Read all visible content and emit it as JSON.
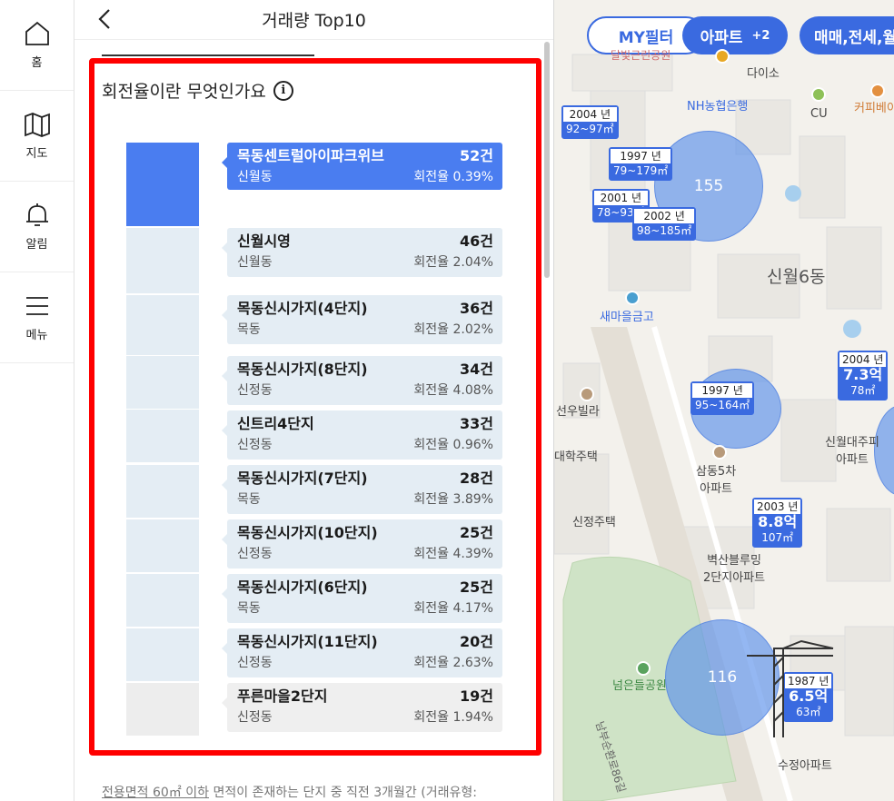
{
  "nav": {
    "home": "홈",
    "map": "지도",
    "alert": "알림",
    "menu": "메뉴"
  },
  "panel": {
    "title": "거래량 Top10",
    "section_title": "회전율이란 무엇인가요",
    "footnote_underlined": "전용면적 60㎡ 이하",
    "footnote_rest": " 면적이 존재하는 단지 중 직전 3개월간 (거래유형:"
  },
  "ranking": [
    {
      "name": "목동센트럴아이파크위브",
      "count": "52건",
      "dong": "신월동",
      "rate": "회전율 0.39%"
    },
    {
      "name": "신월시영",
      "count": "46건",
      "dong": "신월동",
      "rate": "회전율 2.04%"
    },
    {
      "name": "목동신시가지(4단지)",
      "count": "36건",
      "dong": "목동",
      "rate": "회전율 2.02%"
    },
    {
      "name": "목동신시가지(8단지)",
      "count": "34건",
      "dong": "신정동",
      "rate": "회전율 4.08%"
    },
    {
      "name": "신트리4단지",
      "count": "33건",
      "dong": "신정동",
      "rate": "회전율 0.96%"
    },
    {
      "name": "목동신시가지(7단지)",
      "count": "28건",
      "dong": "목동",
      "rate": "회전율 3.89%"
    },
    {
      "name": "목동신시가지(10단지)",
      "count": "25건",
      "dong": "신정동",
      "rate": "회전율 4.39%"
    },
    {
      "name": "목동신시가지(6단지)",
      "count": "25건",
      "dong": "목동",
      "rate": "회전율 4.17%"
    },
    {
      "name": "목동신시가지(11단지)",
      "count": "20건",
      "dong": "신정동",
      "rate": "회전율 2.63%"
    },
    {
      "name": "푸른마을2단지",
      "count": "19건",
      "dong": "신정동",
      "rate": "회전율 1.94%"
    }
  ],
  "map": {
    "filters": {
      "my_filter": "MY필터",
      "apartment": "아파트",
      "apartment_extra": "+2",
      "trade": "매매,전세,월"
    },
    "clusters": [
      "155",
      "116"
    ],
    "markers": [
      {
        "year": "2004 년",
        "value": "92~97㎡"
      },
      {
        "year": "1997 년",
        "value": "79~179㎡"
      },
      {
        "year": "2001 년",
        "value": "78~93㎡"
      },
      {
        "year": "2002 년",
        "value": "98~185㎡"
      },
      {
        "year": "1997 년",
        "value": "95~164㎡"
      },
      {
        "year": "2004 년",
        "price": "7.3억",
        "area": "78㎡"
      },
      {
        "year": "2003 년",
        "price": "8.8억",
        "area": "107㎡"
      },
      {
        "year": "1987 년",
        "price": "6.5억",
        "area": "63㎡"
      }
    ],
    "labels": {
      "daiso": "다이소",
      "nh": "NH농협은행",
      "cu": "CU",
      "coffee": "커피베이",
      "dong": "신월6동",
      "bank": "새마을금고",
      "villa1": "선우빌라",
      "villa2": "대학주택",
      "villa3": "신정주택",
      "apt1": "삼동5차\n아파트",
      "apt2": "벽산블루밍\n2단지아파트",
      "apt3": "신월대주피\n아파트",
      "apt4": "수정아파트",
      "park": "넘은들공원",
      "park_top": "달빛근린공원",
      "road": "남부순환로86길"
    }
  }
}
